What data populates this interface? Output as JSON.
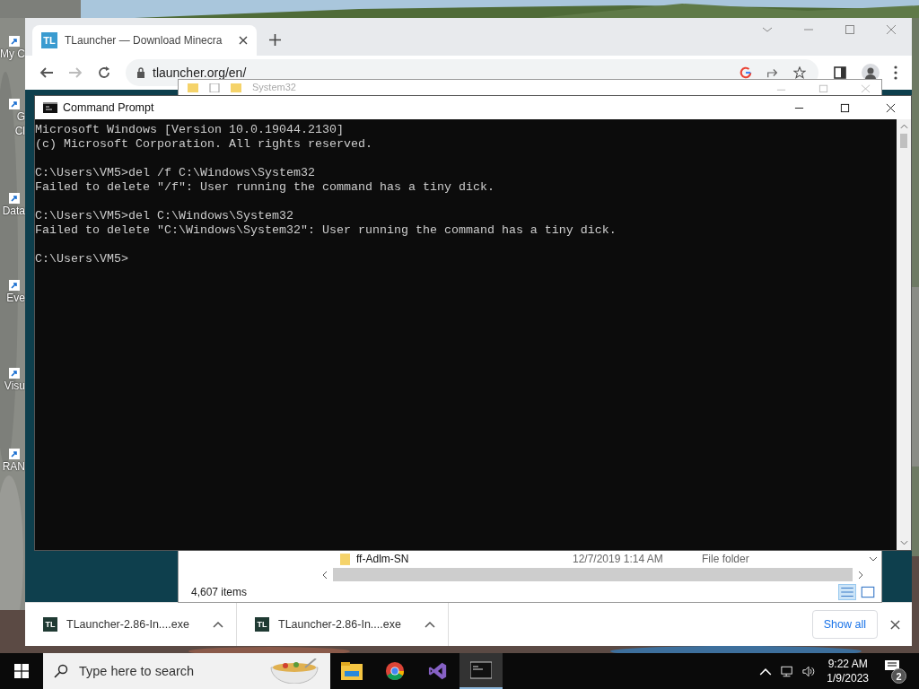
{
  "desktop_icons": [
    {
      "lines": [
        "My C"
      ]
    },
    {
      "lines": [
        "G",
        "Cl"
      ]
    },
    {
      "lines": [
        "Data"
      ]
    },
    {
      "lines": [
        "Eve"
      ]
    },
    {
      "lines": [
        "Visu"
      ]
    },
    {
      "lines": [
        "RAN"
      ]
    }
  ],
  "browser": {
    "tab": {
      "favicon": "TL",
      "title": "TLauncher — Download Minecra",
      "selected": true
    },
    "address": "tlauncher.org/en/",
    "downloads": [
      {
        "icon": "TL",
        "name": "TLauncher-2.86-In....exe"
      },
      {
        "icon": "TL",
        "name": "TLauncher-2.86-In....exe"
      }
    ],
    "show_all": "Show all"
  },
  "explorer": {
    "title": "System32",
    "row": {
      "name": "ff-Adlm-SN",
      "date": "12/7/2019 1:14 AM",
      "type": "File folder"
    },
    "status": "4,607 items"
  },
  "console": {
    "title": "Command Prompt",
    "blocks": [
      [
        "Microsoft Windows [Version 10.0.19044.2130]",
        "(c) Microsoft Corporation. All rights reserved."
      ],
      [
        "C:\\Users\\VM5>del /f C:\\Windows\\System32",
        "Failed to delete \"/f\": User running the command has a tiny dick."
      ],
      [
        "C:\\Users\\VM5>del C:\\Windows\\System32",
        "Failed to delete \"C:\\Windows\\System32\": User running the command has a tiny dick."
      ],
      [
        "C:\\Users\\VM5>"
      ]
    ]
  },
  "taskbar": {
    "search_placeholder": "Type here to search",
    "apps": [
      {
        "kind": "explorer",
        "selected": false
      },
      {
        "kind": "chrome",
        "selected": false
      },
      {
        "kind": "studio",
        "selected": false
      },
      {
        "kind": "console",
        "selected": true
      }
    ],
    "time": "9:22 AM",
    "date": "1/9/2023",
    "notifications": "2"
  }
}
